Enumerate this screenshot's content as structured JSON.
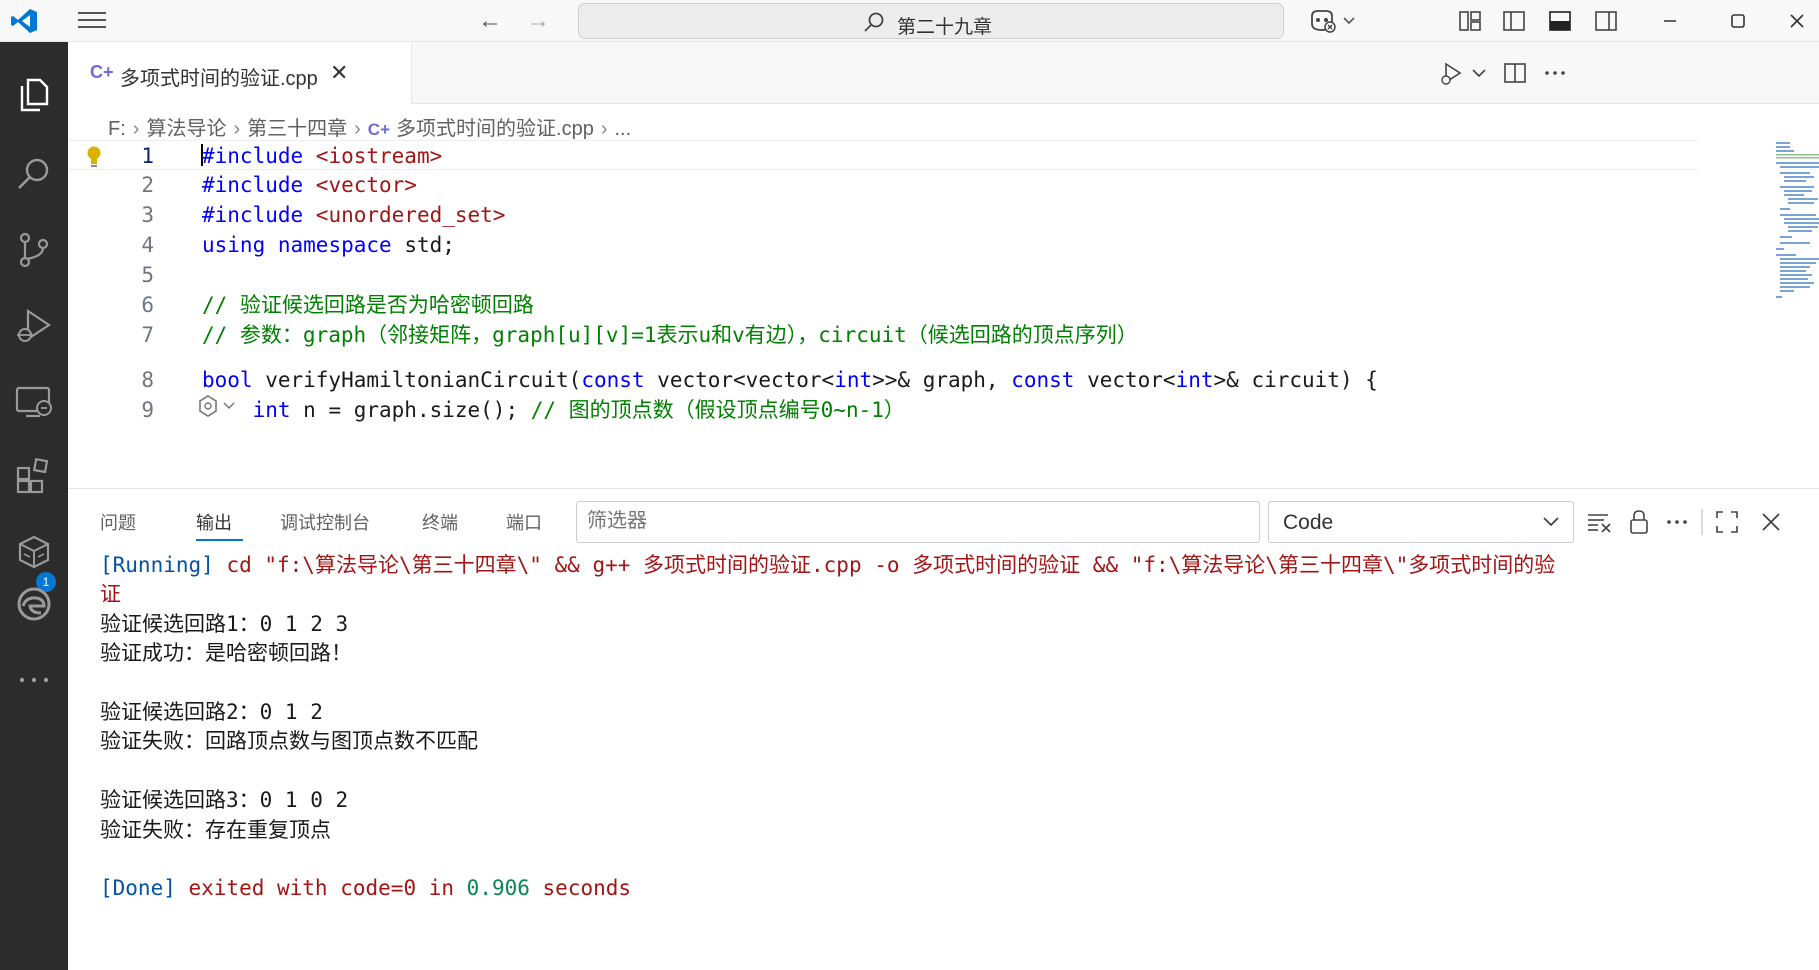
{
  "titlebar": {
    "search_text": "第二十九章"
  },
  "activity": {
    "extensions_badge": "1"
  },
  "editor": {
    "tab_label": "多项式时间的验证.cpp",
    "tab_icon": "C+",
    "breadcrumb": [
      "F:",
      "算法导论",
      "第三十四章",
      "多项式时间的验证.cpp",
      "..."
    ]
  },
  "code": {
    "line_numbers": [
      "1",
      "2",
      "3",
      "4",
      "5",
      "6",
      "7",
      "8",
      "9"
    ],
    "lines": [
      [
        {
          "t": "#include ",
          "c": "dir"
        },
        {
          "t": "<iostream>",
          "c": "str"
        }
      ],
      [
        {
          "t": "#include ",
          "c": "dir"
        },
        {
          "t": "<vector>",
          "c": "str"
        }
      ],
      [
        {
          "t": "#include ",
          "c": "dir"
        },
        {
          "t": "<unordered_set>",
          "c": "str"
        }
      ],
      [
        {
          "t": "using",
          "c": "kw"
        },
        {
          "t": " ",
          "c": "id"
        },
        {
          "t": "namespace",
          "c": "kw"
        },
        {
          "t": " std;",
          "c": "id"
        }
      ],
      [],
      [
        {
          "t": "// 验证候选回路是否为哈密顿回路",
          "c": "cm"
        }
      ],
      [
        {
          "t": "// 参数：graph（邻接矩阵，graph[u][v]=1表示u和v有边），circuit（候选回路的顶点序列）",
          "c": "cm"
        }
      ],
      [
        {
          "t": "bool",
          "c": "kw"
        },
        {
          "t": " verifyHamiltonianCircuit(",
          "c": "id"
        },
        {
          "t": "const",
          "c": "kw"
        },
        {
          "t": " vector<vector<",
          "c": "id"
        },
        {
          "t": "int",
          "c": "kw"
        },
        {
          "t": ">>& graph, ",
          "c": "id"
        },
        {
          "t": "const",
          "c": "kw"
        },
        {
          "t": " vector<",
          "c": "id"
        },
        {
          "t": "int",
          "c": "kw"
        },
        {
          "t": ">& circuit) {",
          "c": "id"
        }
      ],
      [
        {
          "t": "    ",
          "c": "id"
        },
        {
          "t": "int",
          "c": "kw"
        },
        {
          "t": " n = graph.size(); ",
          "c": "id"
        },
        {
          "t": "// 图的顶点数（假设顶点编号0~n-1）",
          "c": "cm"
        }
      ]
    ]
  },
  "panel": {
    "tabs": [
      "问题",
      "输出",
      "调试控制台",
      "终端",
      "端口"
    ],
    "active_tab": "输出",
    "filter_placeholder": "筛选器",
    "channel": "Code",
    "output": [
      [
        {
          "t": "[Running]",
          "c": "o-blue"
        },
        {
          "t": " cd \"f:\\算法导论\\第三十四章\\\" && g++ 多项式时间的验证.cpp -o 多项式时间的验证 && \"f:\\算法导论\\第三十四章\\\"多项式时间的验",
          "c": "o-red"
        }
      ],
      [
        {
          "t": "证",
          "c": "o-red"
        }
      ],
      [
        {
          "t": "验证候选回路1：0 1 2 3",
          "c": ""
        }
      ],
      [
        {
          "t": "验证成功：是哈密顿回路！",
          "c": ""
        }
      ],
      [
        {
          "t": "",
          "c": ""
        }
      ],
      [
        {
          "t": "验证候选回路2：0 1 2",
          "c": ""
        }
      ],
      [
        {
          "t": "验证失败：回路顶点数与图顶点数不匹配",
          "c": ""
        }
      ],
      [
        {
          "t": "",
          "c": ""
        }
      ],
      [
        {
          "t": "验证候选回路3：0 1 0 2",
          "c": ""
        }
      ],
      [
        {
          "t": "验证失败：存在重复顶点",
          "c": ""
        }
      ],
      [
        {
          "t": "",
          "c": ""
        }
      ],
      [
        {
          "t": "[Done]",
          "c": "o-blue"
        },
        {
          "t": " exited with ",
          "c": "o-red"
        },
        {
          "t": "code=0",
          "c": "o-red"
        },
        {
          "t": " in ",
          "c": "o-red"
        },
        {
          "t": "0.906",
          "c": "o-green"
        },
        {
          "t": " seconds",
          "c": "o-red"
        }
      ]
    ]
  },
  "colors": {
    "accent": "#0078d4",
    "activity_bg": "#2c2c2c",
    "keyword": "#0000ff",
    "string": "#a31515",
    "comment": "#008000"
  }
}
